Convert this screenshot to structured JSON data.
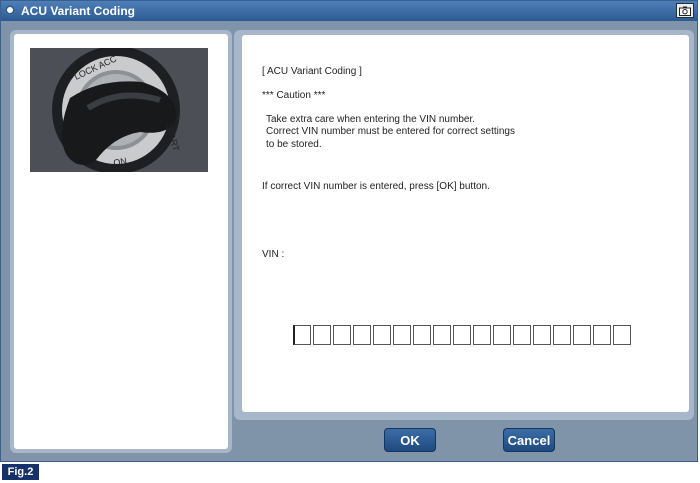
{
  "window": {
    "title": "ACU Variant Coding",
    "camera_icon": "camera-icon"
  },
  "content": {
    "heading": "[ ACU Variant Coding ]",
    "caution": "*** Caution ***",
    "line1": "Take extra care when entering the VIN number.",
    "line2": "Correct VIN number must be entered for correct settings",
    "line3": "to be stored.",
    "instruction": "If correct VIN number is entered, press [OK] button.",
    "vin_label": "VIN :",
    "vin_value": ""
  },
  "image": {
    "ring_text_top": "LOCK  ACC",
    "ring_text_right": "START",
    "ring_text_bottom": "ON"
  },
  "buttons": {
    "ok": "OK",
    "cancel": "Cancel"
  },
  "figure_label": "Fig.2"
}
